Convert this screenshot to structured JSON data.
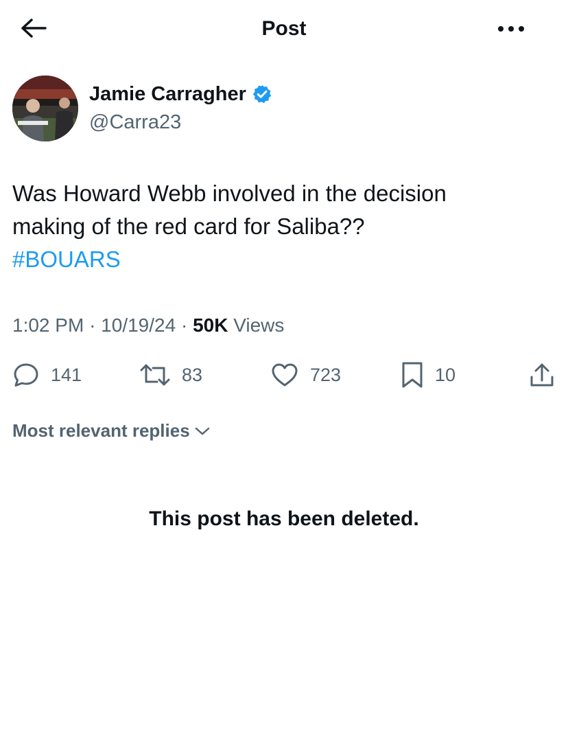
{
  "header": {
    "title": "Post"
  },
  "author": {
    "name": "Jamie Carragher",
    "handle": "@Carra23",
    "verified": true
  },
  "tweet": {
    "lines": [
      "Was Howard Webb involved in the decision",
      "making of the red card for Saliba??"
    ],
    "hashtag": "#BOUARS"
  },
  "meta": {
    "time": "1:02 PM",
    "separator": "·",
    "date": "10/19/24",
    "views_count": "50K",
    "views_label": "Views"
  },
  "actions": {
    "replies": "141",
    "reposts": "83",
    "likes": "723",
    "bookmarks": "10"
  },
  "replies_sort": {
    "label": "Most relevant replies"
  },
  "deleted_notice": "This post has been deleted.",
  "colors": {
    "text": "#0f1419",
    "secondary": "#536471",
    "accent": "#1d9bf0"
  },
  "icons": [
    "back-arrow-icon",
    "more-icon",
    "verified-badge-icon",
    "reply-icon",
    "repost-icon",
    "like-icon",
    "bookmark-icon",
    "share-icon",
    "chevron-down-icon"
  ]
}
